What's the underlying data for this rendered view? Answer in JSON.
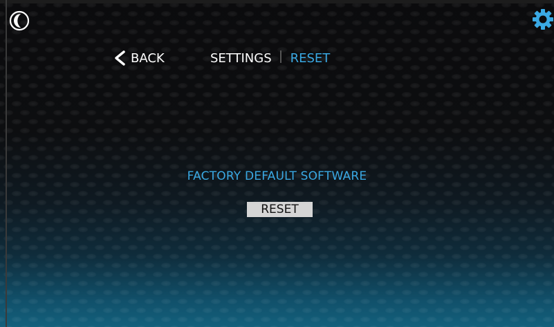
{
  "header": {
    "theme_icon": "moon-icon",
    "settings_icon": "gear-icon",
    "back_label": "BACK",
    "breadcrumb": {
      "settings": "SETTINGS",
      "current": "RESET"
    }
  },
  "main": {
    "section_title": "FACTORY DEFAULT SOFTWARE",
    "reset_button_label": "RESET"
  },
  "colors": {
    "accent": "#3aa9e4",
    "button_bg": "#d5d5d5",
    "text": "#ffffff"
  }
}
